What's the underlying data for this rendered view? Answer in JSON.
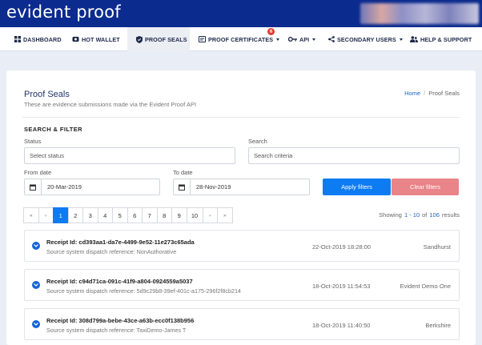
{
  "brand": "evident proof",
  "nav": {
    "dashboard": "DASHBOARD",
    "hot_wallet": "HOT WALLET",
    "proof_seals": "PROOF SEALS",
    "proof_certificates": "PROOF CERTIFICATES",
    "proof_certificates_badge": "6",
    "api": "API",
    "secondary_users": "SECONDARY USERS",
    "help_support": "HELP & SUPPORT"
  },
  "page": {
    "title": "Proof Seals",
    "subtitle": "These are evidence submissions made via the Evident Proof API",
    "breadcrumb": {
      "home": "Home",
      "sep": "/",
      "current": "Proof Seals"
    }
  },
  "filter": {
    "section_title": "SEARCH & FILTER",
    "status_label": "Status",
    "status_placeholder": "Select status",
    "search_label": "Search",
    "search_placeholder": "Search criteria",
    "from_label": "From date",
    "from_value": "20-Mar-2019",
    "to_label": "To date",
    "to_value": "28-Nov-2019",
    "apply_label": "Apply filters",
    "clear_label": "Clear filters"
  },
  "pagination": {
    "first": "«",
    "prev": "‹",
    "pages": [
      "1",
      "2",
      "3",
      "4",
      "5",
      "6",
      "7",
      "8",
      "9",
      "10"
    ],
    "active": "1",
    "next": "›",
    "last": "»"
  },
  "results": {
    "showing": "Showing",
    "range": "1 - 10",
    "of": "of",
    "total": "106",
    "suffix": "results"
  },
  "receipts": [
    {
      "title": "Receipt Id: cd393aa1-da7e-4499-9e52-11e273c65ada",
      "sub": "Source system dispatch reference: NonAuthorative",
      "date": "22-Oct-2019 18:28:00",
      "location": "Sandhurst"
    },
    {
      "title": "Receipt Id: c94d71ca-091c-41f9-a804-0924559a5037",
      "sub": "Source system dispatch reference: 5d9c29b8-39ef-401c-a175-296f2f8cb214",
      "date": "18-Oct-2019 11:54:53",
      "location": "Evident Demo One"
    },
    {
      "title": "Receipt Id: 308d799a-bebe-43ce-a63b-ecc0f138b956",
      "sub": "Source system dispatch reference: TaxiDemo-James T",
      "date": "18-Oct-2019 11:40:50",
      "location": "Berkshire"
    }
  ],
  "colors": {
    "topbar": "#0c2b8e",
    "primary": "#0d7cf2",
    "danger_light": "#e98489",
    "badge": "#e53935"
  }
}
